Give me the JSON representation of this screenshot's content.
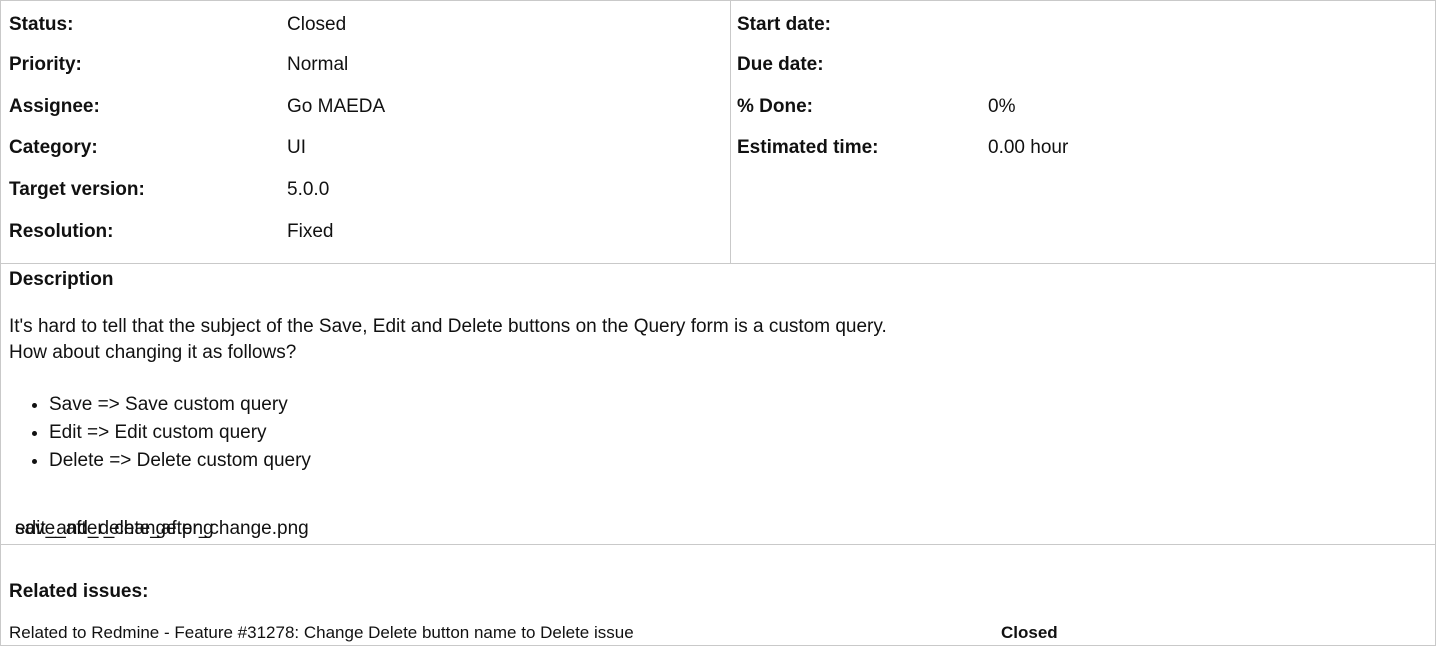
{
  "attributes_left": [
    {
      "label": "Status:",
      "value": "Closed"
    },
    {
      "label": "Priority:",
      "value": "Normal"
    },
    {
      "label": "Assignee:",
      "value": "Go MAEDA"
    },
    {
      "label": "Category:",
      "value": "UI"
    },
    {
      "label": "Target version:",
      "value": "5.0.0"
    },
    {
      "label": "Resolution:",
      "value": "Fixed"
    }
  ],
  "attributes_right": [
    {
      "label": "Start date:",
      "value": ""
    },
    {
      "label": "Due date:",
      "value": ""
    },
    {
      "label": "% Done:",
      "value": "0%"
    },
    {
      "label": "Estimated time:",
      "value": "0.00 hour"
    }
  ],
  "description": {
    "heading": "Description",
    "line1": "It's hard to tell that the subject of the Save, Edit and Delete buttons on the Query form is a custom query.",
    "line2": "How about changing it as follows?",
    "items": [
      "Save => Save custom query",
      "Edit => Edit custom query",
      "Delete => Delete custom query"
    ],
    "attachment_a": "save_after_change.png",
    "attachment_b": "edit_and_delete_after_change.png"
  },
  "related": {
    "heading": "Related issues:",
    "text": "Related to Redmine - Feature #31278: Change Delete button name to Delete issue",
    "status": "Closed"
  }
}
